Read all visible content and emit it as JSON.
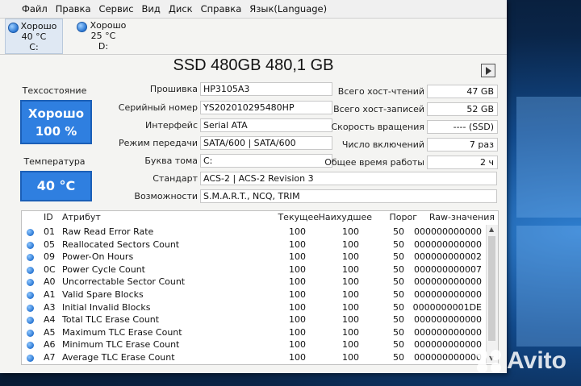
{
  "menu": [
    "Файл",
    "Правка",
    "Сервис",
    "Вид",
    "Диск",
    "Справка",
    "Язык(Language)"
  ],
  "drives": [
    {
      "status": "Хорошо",
      "temp": "40 °C",
      "letter": "C:"
    },
    {
      "status": "Хорошо",
      "temp": "25 °C",
      "letter": "D:"
    }
  ],
  "title": "SSD 480GB 480,1 GB",
  "left": {
    "health_label": "Техсостояние",
    "health_status": "Хорошо",
    "health_percent": "100 %",
    "temp_label": "Температура",
    "temp_value": "40 °C"
  },
  "info": {
    "firmware": {
      "label": "Прошивка",
      "value": "HP3105A3"
    },
    "serial": {
      "label": "Серийный номер",
      "value": "YS202010295480HP"
    },
    "interface": {
      "label": "Интерфейс",
      "value": "Serial ATA"
    },
    "transfer": {
      "label": "Режим передачи",
      "value": "SATA/600 | SATA/600"
    },
    "volume": {
      "label": "Буква тома",
      "value": "C:"
    },
    "standard": {
      "label": "Стандарт",
      "value": "ACS-2 | ACS-2 Revision 3"
    },
    "features": {
      "label": "Возможности",
      "value": "S.M.A.R.T., NCQ, TRIM"
    },
    "host_reads": {
      "label": "Всего хост-чтений",
      "value": "47 GB"
    },
    "host_writes": {
      "label": "Всего хост-записей",
      "value": "52 GB"
    },
    "rotation": {
      "label": "Скорость вращения",
      "value": "---- (SSD)"
    },
    "power_count": {
      "label": "Число включений",
      "value": "7 раз"
    },
    "power_hours": {
      "label": "Общее время работы",
      "value": "2 ч"
    }
  },
  "smart": {
    "headers": {
      "id": "ID",
      "attr": "Атрибут",
      "cur": "Текущее",
      "worst": "Наихудшее",
      "thr": "Порог",
      "raw": "Raw-значения"
    },
    "rows": [
      {
        "id": "01",
        "attr": "Raw Read Error Rate",
        "cur": "100",
        "worst": "100",
        "thr": "50",
        "raw": "000000000000"
      },
      {
        "id": "05",
        "attr": "Reallocated Sectors Count",
        "cur": "100",
        "worst": "100",
        "thr": "50",
        "raw": "000000000000"
      },
      {
        "id": "09",
        "attr": "Power-On Hours",
        "cur": "100",
        "worst": "100",
        "thr": "50",
        "raw": "000000000002"
      },
      {
        "id": "0C",
        "attr": "Power Cycle Count",
        "cur": "100",
        "worst": "100",
        "thr": "50",
        "raw": "000000000007"
      },
      {
        "id": "A0",
        "attr": "Uncorrectable Sector Count",
        "cur": "100",
        "worst": "100",
        "thr": "50",
        "raw": "000000000000"
      },
      {
        "id": "A1",
        "attr": "Valid Spare Blocks",
        "cur": "100",
        "worst": "100",
        "thr": "50",
        "raw": "000000000000"
      },
      {
        "id": "A3",
        "attr": "Initial Invalid Blocks",
        "cur": "100",
        "worst": "100",
        "thr": "50",
        "raw": "0000000001DE"
      },
      {
        "id": "A4",
        "attr": "Total TLC Erase Count",
        "cur": "100",
        "worst": "100",
        "thr": "50",
        "raw": "000000000000"
      },
      {
        "id": "A5",
        "attr": "Maximum TLC Erase Count",
        "cur": "100",
        "worst": "100",
        "thr": "50",
        "raw": "000000000000"
      },
      {
        "id": "A6",
        "attr": "Minimum TLC Erase Count",
        "cur": "100",
        "worst": "100",
        "thr": "50",
        "raw": "000000000000"
      },
      {
        "id": "A7",
        "attr": "Average TLC Erase Count",
        "cur": "100",
        "worst": "100",
        "thr": "50",
        "raw": "000000000000"
      }
    ]
  },
  "watermark": "Avito",
  "colors": {
    "health_blue": "#2f7fe0",
    "desktop_blue": "#124a8c"
  }
}
